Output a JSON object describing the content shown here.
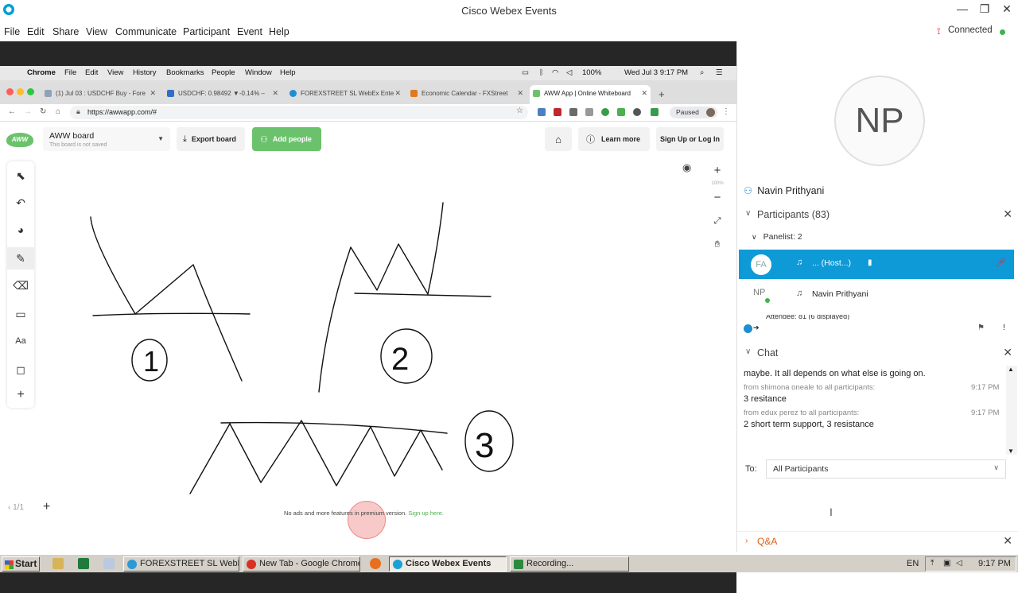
{
  "window": {
    "title": "Cisco Webex Events",
    "minimize": "—",
    "maximize": "❐",
    "close": "✕"
  },
  "menu": [
    "File",
    "Edit",
    "Share",
    "View",
    "Communicate",
    "Participant",
    "Event",
    "Help"
  ],
  "connection": "Connected",
  "mac_menu": {
    "app": "Chrome",
    "items": [
      "File",
      "Edit",
      "View",
      "History",
      "Bookmarks",
      "People",
      "Window",
      "Help"
    ],
    "battery": "100%",
    "datetime": "Wed Jul 3  9:17 PM"
  },
  "browser_tabs": [
    {
      "label": "(1) Jul 03 : USDCHF Buy - Fore",
      "icon_color": "#8fa3b8"
    },
    {
      "label": "USDCHF: 0.98492 ▼-0.14% –",
      "icon_color": "#2f6ec4"
    },
    {
      "label": "FOREXSTREET SL WebEx Ente",
      "icon_color": "#1f8ed1"
    },
    {
      "label": "Economic Calendar - FXStreet",
      "icon_color": "#e07a1e"
    },
    {
      "label": "AWW App | Online Whiteboard",
      "icon_color": "#6bc26c"
    }
  ],
  "address": {
    "url": "https://awwapp.com/#",
    "paused": "Paused"
  },
  "aww": {
    "logo": "AWW",
    "board_title": "AWW board",
    "board_sub": "This board is not saved",
    "export": "Export board",
    "add_people": "Add people",
    "learn_more": "Learn more",
    "signup": "Sign Up or Log In",
    "zoom_level": "100%",
    "page": "1/1",
    "promo_text": "No ads and more features in premium version.",
    "promo_link": "Sign up here.",
    "board_labels": [
      "1",
      "2",
      "3"
    ]
  },
  "right": {
    "avatar_initials": "NP",
    "presenter": "Navin Prithyani",
    "participants_header": "Participants (83)",
    "panelist_header": "Panelist: 2",
    "host_initials": "FA",
    "host_label": "... (Host...)",
    "np_initials": "NP",
    "np_name": "Navin Prithyani",
    "attendee_cut": "Attendee: 81 (6 displayed)",
    "chat_header": "Chat",
    "chat": [
      {
        "kind": "msg",
        "text": "maybe.  It all depends on what else is going on."
      },
      {
        "kind": "from",
        "text": "from shimona oneale to all participants:",
        "time": "9:17 PM"
      },
      {
        "kind": "msg",
        "text": "3 resitance"
      },
      {
        "kind": "from",
        "text": "from edux perez to all participants:",
        "time": "9:17 PM"
      },
      {
        "kind": "msg",
        "text": "2 short term support, 3 resistance"
      }
    ],
    "to_label": "To:",
    "to_value": "All Participants",
    "qa_header": "Q&A"
  },
  "taskbar": {
    "start": "Start",
    "items": [
      {
        "label": "FOREXSTREET SL WebE...",
        "icon_color": "#2b9bd8"
      },
      {
        "label": "New Tab - Google Chrome",
        "icon_color": "#d93025"
      },
      {
        "label": "Cisco Webex Events",
        "icon_color": "#1aa1d6"
      },
      {
        "label": "Recording...",
        "icon_color": "#2c8a3c"
      }
    ],
    "lang": "EN",
    "clock": "9:17 PM"
  }
}
